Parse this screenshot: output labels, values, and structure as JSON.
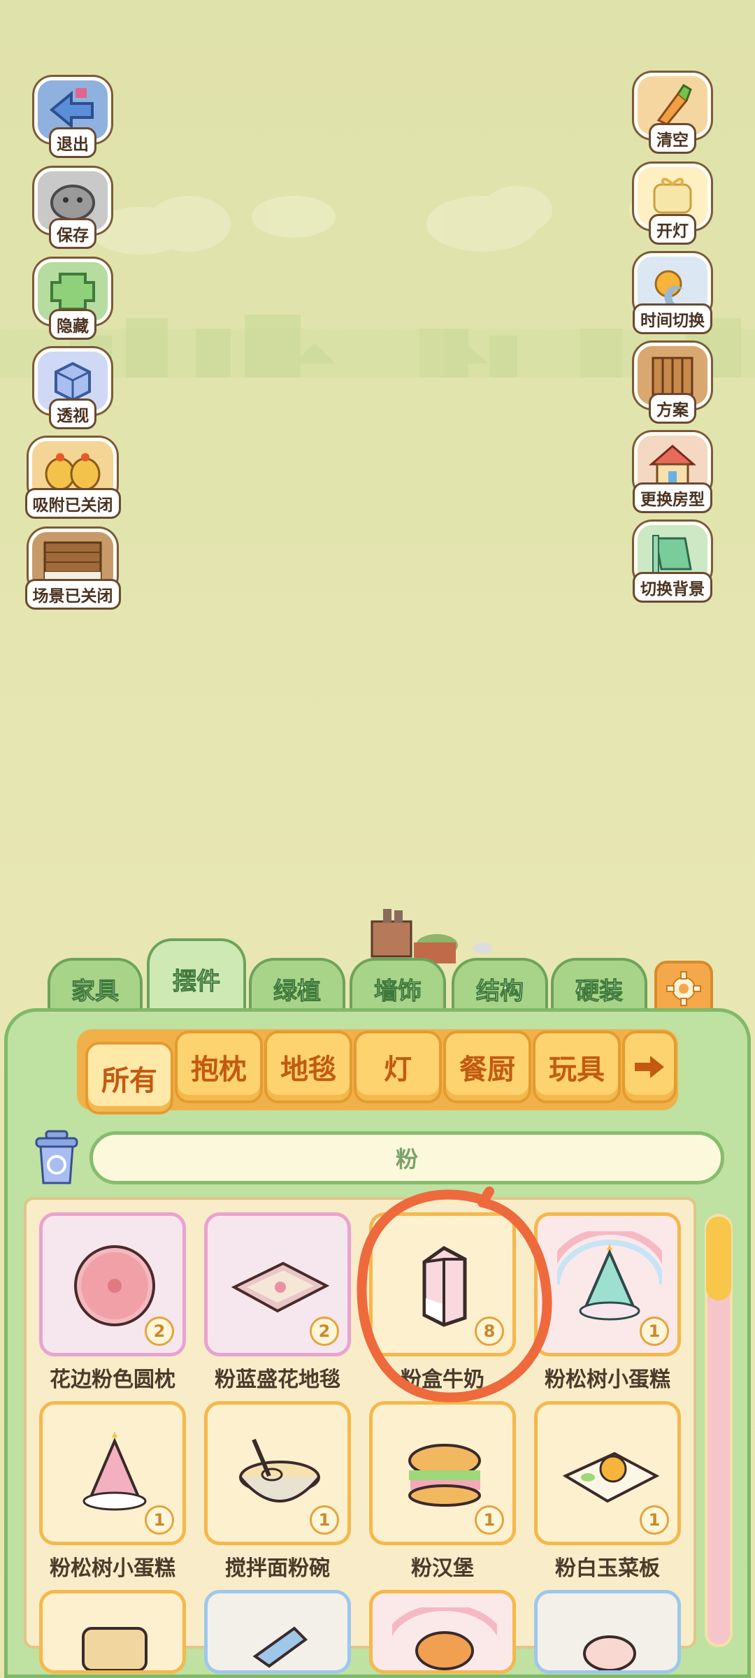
{
  "left_buttons": [
    {
      "label": "退出",
      "icon": "exit-arrow-icon"
    },
    {
      "label": "保存",
      "icon": "save-hamster-icon"
    },
    {
      "label": "隐藏",
      "icon": "hide-icon"
    },
    {
      "label": "透视",
      "icon": "cube-perspective-icon"
    },
    {
      "label": "吸附已关闭",
      "icon": "chicks-snap-icon"
    },
    {
      "label": "场景已关闭",
      "icon": "scene-wall-icon"
    }
  ],
  "right_buttons": [
    {
      "label": "清空",
      "icon": "broom-carrot-icon"
    },
    {
      "label": "开灯",
      "icon": "lamp-icon"
    },
    {
      "label": "时间切换",
      "icon": "sun-moon-icon"
    },
    {
      "label": "方案",
      "icon": "plan-book-icon"
    },
    {
      "label": "更换房型",
      "icon": "house-icon"
    },
    {
      "label": "切换背景",
      "icon": "background-sheet-icon"
    }
  ],
  "category_tabs": [
    {
      "label": "家具",
      "active": false
    },
    {
      "label": "摆件",
      "active": true
    },
    {
      "label": "绿植",
      "active": false
    },
    {
      "label": "墙饰",
      "active": false
    },
    {
      "label": "结构",
      "active": false
    },
    {
      "label": "硬装",
      "active": false
    }
  ],
  "settings_icon": "gear-icon",
  "sub_tabs": [
    {
      "label": "所有",
      "active": true
    },
    {
      "label": "抱枕",
      "active": false
    },
    {
      "label": "地毯",
      "active": false
    },
    {
      "label": "灯",
      "active": false
    },
    {
      "label": "餐厨",
      "active": false
    },
    {
      "label": "玩具",
      "active": false
    }
  ],
  "sub_tabs_more_icon": "arrow-right-icon",
  "trash_icon": "recycle-bin-icon",
  "search": {
    "value": "粉"
  },
  "items": [
    {
      "name": "花边粉色圆枕",
      "count": "2",
      "frame": "pink"
    },
    {
      "name": "粉蓝盛花地毯",
      "count": "2",
      "frame": "pink"
    },
    {
      "name": "粉盒牛奶",
      "count": "8",
      "frame": "gold"
    },
    {
      "name": "粉松树小蛋糕",
      "count": "1",
      "frame": "rainbow"
    },
    {
      "name": "粉松树小蛋糕",
      "count": "1",
      "frame": "gold"
    },
    {
      "name": "搅拌面粉碗",
      "count": "1",
      "frame": "gold"
    },
    {
      "name": "粉汉堡",
      "count": "1",
      "frame": "gold"
    },
    {
      "name": "粉白玉菜板",
      "count": "1",
      "frame": "gold"
    }
  ],
  "colors": {
    "annotation": "#ee6a3c",
    "panel": "#bfe1a2",
    "accent_orange": "#f1b14a"
  }
}
